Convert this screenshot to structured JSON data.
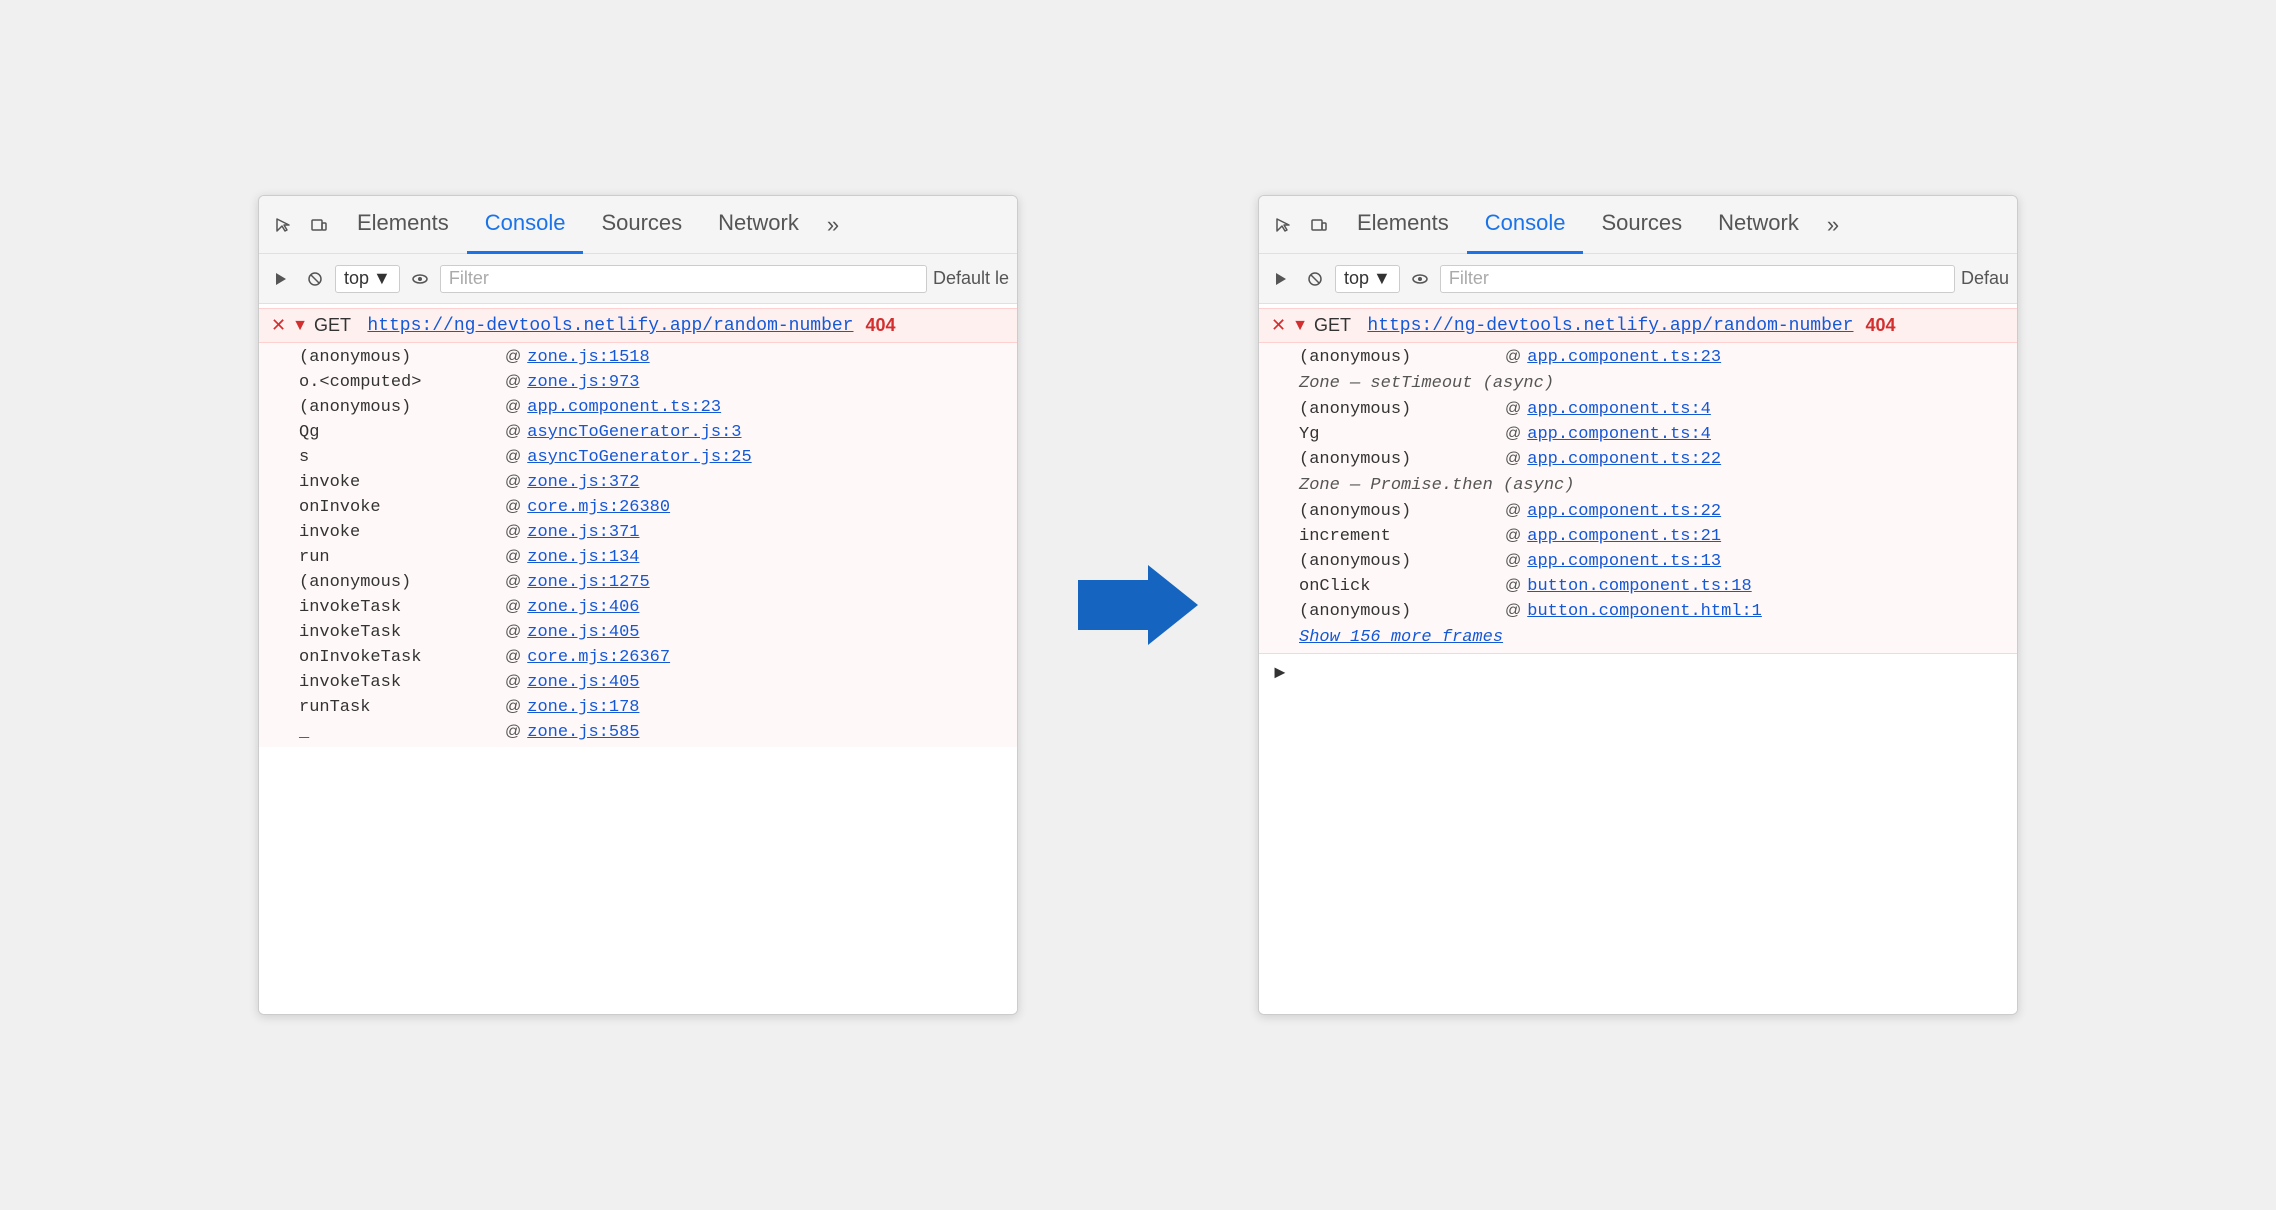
{
  "panel_left": {
    "tabs": [
      {
        "id": "elements",
        "label": "Elements",
        "active": false
      },
      {
        "id": "console",
        "label": "Console",
        "active": true
      },
      {
        "id": "sources",
        "label": "Sources",
        "active": false
      },
      {
        "id": "network",
        "label": "Network",
        "active": false
      },
      {
        "id": "more",
        "label": "»",
        "active": false
      }
    ],
    "toolbar": {
      "context": "top",
      "filter_placeholder": "Filter",
      "default_label": "Default le"
    },
    "error": {
      "method": "GET",
      "url": "https://ng-devtools.netlify.app/random-number",
      "code": "404"
    },
    "frames": [
      {
        "fn": "(anonymous)",
        "at": "@",
        "loc": "zone.js:1518"
      },
      {
        "fn": "o.<computed>",
        "at": "@",
        "loc": "zone.js:973"
      },
      {
        "fn": "(anonymous)",
        "at": "@",
        "loc": "app.component.ts:23"
      },
      {
        "fn": "Qg",
        "at": "@",
        "loc": "asyncToGenerator.js:3"
      },
      {
        "fn": "s",
        "at": "@",
        "loc": "asyncToGenerator.js:25"
      },
      {
        "fn": "invoke",
        "at": "@",
        "loc": "zone.js:372"
      },
      {
        "fn": "onInvoke",
        "at": "@",
        "loc": "core.mjs:26380"
      },
      {
        "fn": "invoke",
        "at": "@",
        "loc": "zone.js:371"
      },
      {
        "fn": "run",
        "at": "@",
        "loc": "zone.js:134"
      },
      {
        "fn": "(anonymous)",
        "at": "@",
        "loc": "zone.js:1275"
      },
      {
        "fn": "invokeTask",
        "at": "@",
        "loc": "zone.js:406"
      },
      {
        "fn": "invokeTask",
        "at": "@",
        "loc": "zone.js:405"
      },
      {
        "fn": "onInvokeTask",
        "at": "@",
        "loc": "core.mjs:26367"
      },
      {
        "fn": "invokeTask",
        "at": "@",
        "loc": "zone.js:405"
      },
      {
        "fn": "runTask",
        "at": "@",
        "loc": "zone.js:178"
      },
      {
        "fn": "_",
        "at": "@",
        "loc": "zone.js:585"
      }
    ]
  },
  "panel_right": {
    "tabs": [
      {
        "id": "elements",
        "label": "Elements",
        "active": false
      },
      {
        "id": "console",
        "label": "Console",
        "active": true
      },
      {
        "id": "sources",
        "label": "Sources",
        "active": false
      },
      {
        "id": "network",
        "label": "Network",
        "active": false
      },
      {
        "id": "more",
        "label": "»",
        "active": false
      }
    ],
    "toolbar": {
      "context": "top",
      "filter_placeholder": "Filter",
      "default_label": "Defau"
    },
    "error": {
      "method": "GET",
      "url": "https://ng-devtools.netlify.app/random-number",
      "code": "404"
    },
    "frames": [
      {
        "fn": "(anonymous)",
        "at": "@",
        "loc": "app.component.ts:23",
        "async_before": null
      },
      {
        "fn": "Zone — setTimeout (async)",
        "at": null,
        "loc": null,
        "is_async": true
      },
      {
        "fn": "(anonymous)",
        "at": "@",
        "loc": "app.component.ts:4"
      },
      {
        "fn": "Yg",
        "at": "@",
        "loc": "app.component.ts:4"
      },
      {
        "fn": "(anonymous)",
        "at": "@",
        "loc": "app.component.ts:22"
      },
      {
        "fn": "Zone — Promise.then (async)",
        "at": null,
        "loc": null,
        "is_async": true
      },
      {
        "fn": "(anonymous)",
        "at": "@",
        "loc": "app.component.ts:22"
      },
      {
        "fn": "increment",
        "at": "@",
        "loc": "app.component.ts:21"
      },
      {
        "fn": "(anonymous)",
        "at": "@",
        "loc": "app.component.ts:13"
      },
      {
        "fn": "onClick",
        "at": "@",
        "loc": "button.component.ts:18"
      },
      {
        "fn": "(anonymous)",
        "at": "@",
        "loc": "button.component.html:1"
      }
    ],
    "show_more": "Show 156 more frames",
    "prompt": ">"
  }
}
